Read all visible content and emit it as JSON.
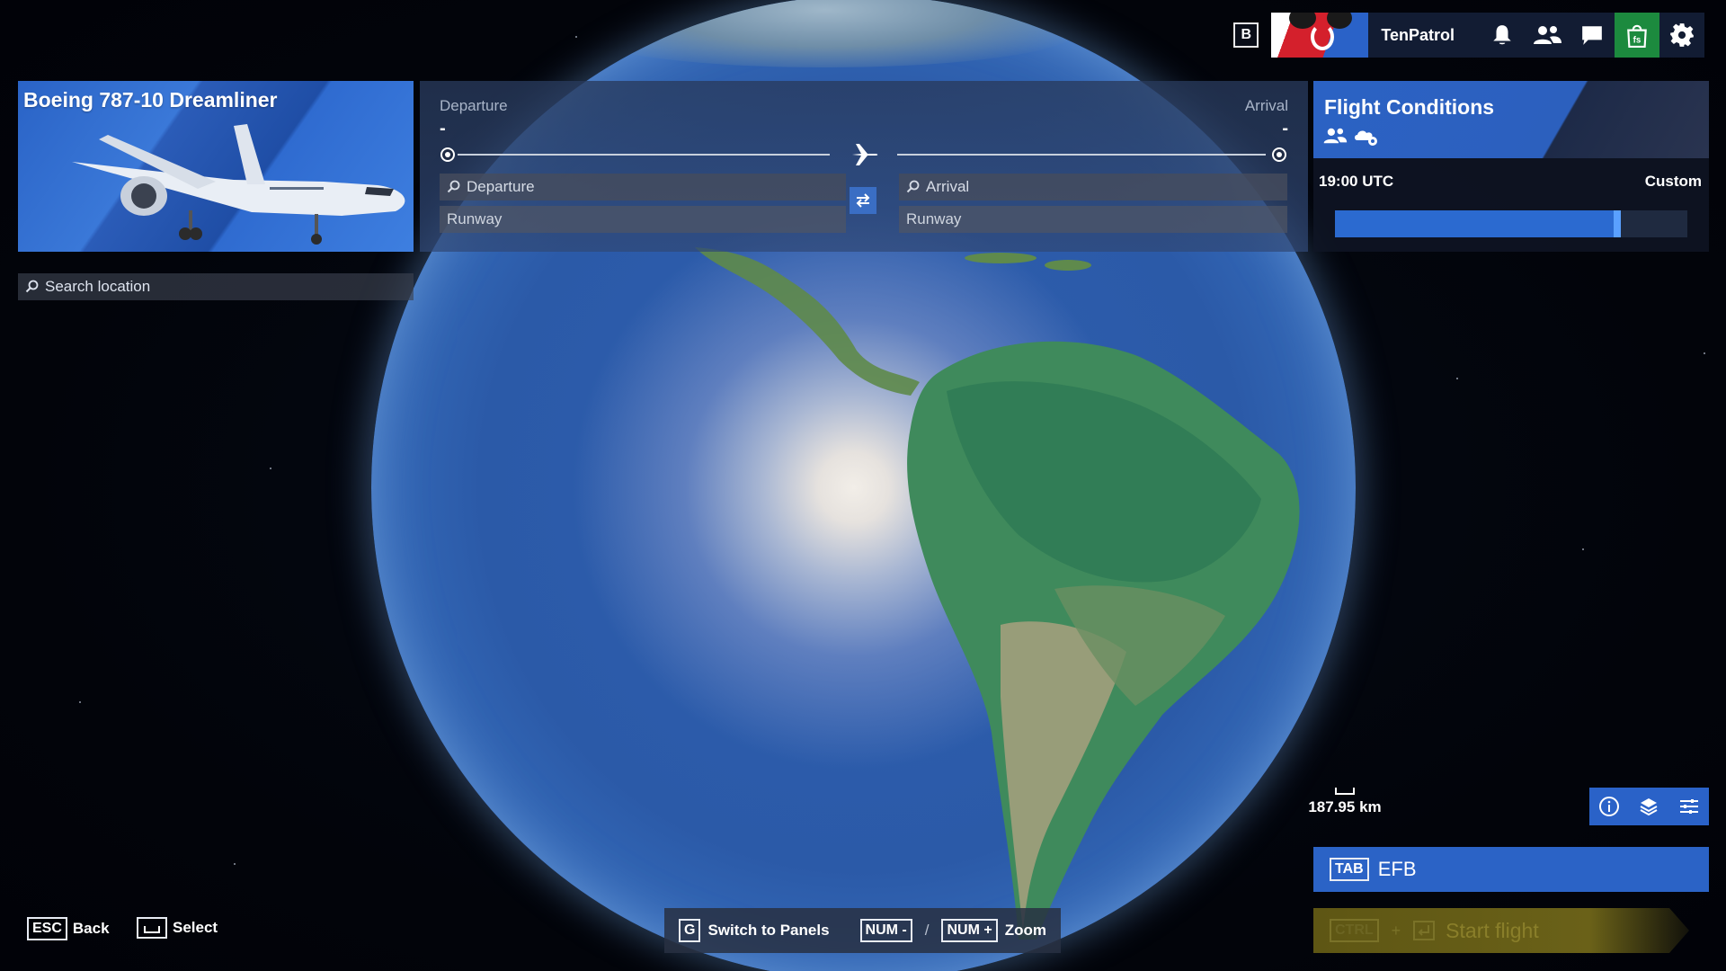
{
  "topbar": {
    "key_b": "B",
    "username": "TenPatrol",
    "icons": [
      "bell-icon",
      "friends-icon",
      "chat-icon",
      "marketplace-icon",
      "gear-icon"
    ]
  },
  "aircraft": {
    "name": "Boeing 787-10 Dreamliner"
  },
  "search": {
    "placeholder": "Search location"
  },
  "route": {
    "departure_label": "Departure",
    "arrival_label": "Arrival",
    "departure_value": "-",
    "arrival_value": "-",
    "departure_input": "Departure",
    "arrival_input": "Arrival",
    "departure_runway": "Runway",
    "arrival_runway": "Runway"
  },
  "conditions": {
    "title": "Flight Conditions",
    "time": "19:00 UTC",
    "mode": "Custom",
    "time_slider_fraction": 0.8
  },
  "map": {
    "scale": "187.95 km"
  },
  "efb": {
    "key": "TAB",
    "label": "EFB"
  },
  "start_flight": {
    "key": "CTRL",
    "plus": "+",
    "label": "Start flight"
  },
  "hints": {
    "back_key": "ESC",
    "back_label": "Back",
    "select_label": "Select",
    "switch_key": "G",
    "switch_label": "Switch to Panels",
    "zoom_out_key": "NUM -",
    "slash": "/",
    "zoom_in_key": "NUM +",
    "zoom_label": "Zoom"
  },
  "colors": {
    "accent": "#2b63c6",
    "start_flight": "#5e5614",
    "marketplace": "#1c8a3e"
  }
}
